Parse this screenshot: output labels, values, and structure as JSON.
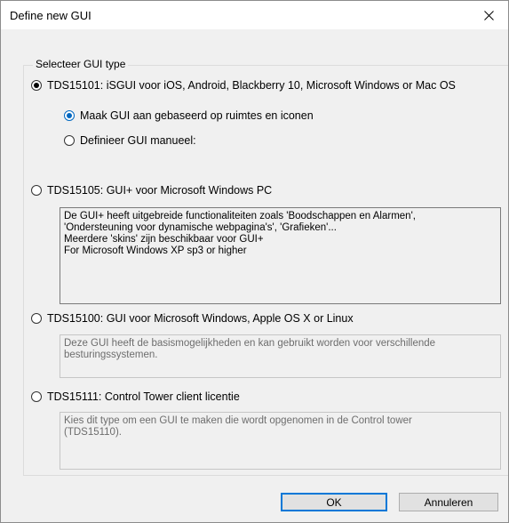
{
  "window": {
    "title": "Define new GUI",
    "close_icon": "close-icon"
  },
  "group": {
    "legend": "Selecteer GUI type"
  },
  "options": [
    {
      "label": "TDS15101: iSGUI voor iOS, Android, Blackberry 10, Microsoft Windows or Mac OS",
      "checked": true,
      "suboptions": [
        {
          "label": "Maak GUI aan gebaseerd op ruimtes en iconen",
          "checked": true
        },
        {
          "label": "Definieer GUI manueel:",
          "checked": false
        }
      ]
    },
    {
      "label": "TDS15105: GUI+ voor Microsoft Windows PC",
      "checked": false,
      "description": [
        "De GUI+ heeft uitgebreide functionaliteiten zoals 'Boodschappen en Alarmen',",
        "'Ondersteuning voor dynamische webpagina's', 'Grafieken'...",
        "Meerdere 'skins' zijn beschikbaar voor GUI+",
        "For Microsoft Windows XP sp3 or higher"
      ]
    },
    {
      "label": "TDS15100: GUI voor Microsoft Windows, Apple OS X or Linux",
      "checked": false,
      "description": [
        "Deze GUI heeft de basismogelijkheden en kan gebruikt worden voor verschillende",
        "besturingssystemen."
      ]
    },
    {
      "label": "TDS15111: Control Tower client licentie",
      "checked": false,
      "description": [
        "Kies dit type om een GUI te maken die wordt opgenomen in de Control tower",
        "(TDS15110)."
      ]
    }
  ],
  "buttons": {
    "ok": "OK",
    "cancel": "Annuleren"
  }
}
